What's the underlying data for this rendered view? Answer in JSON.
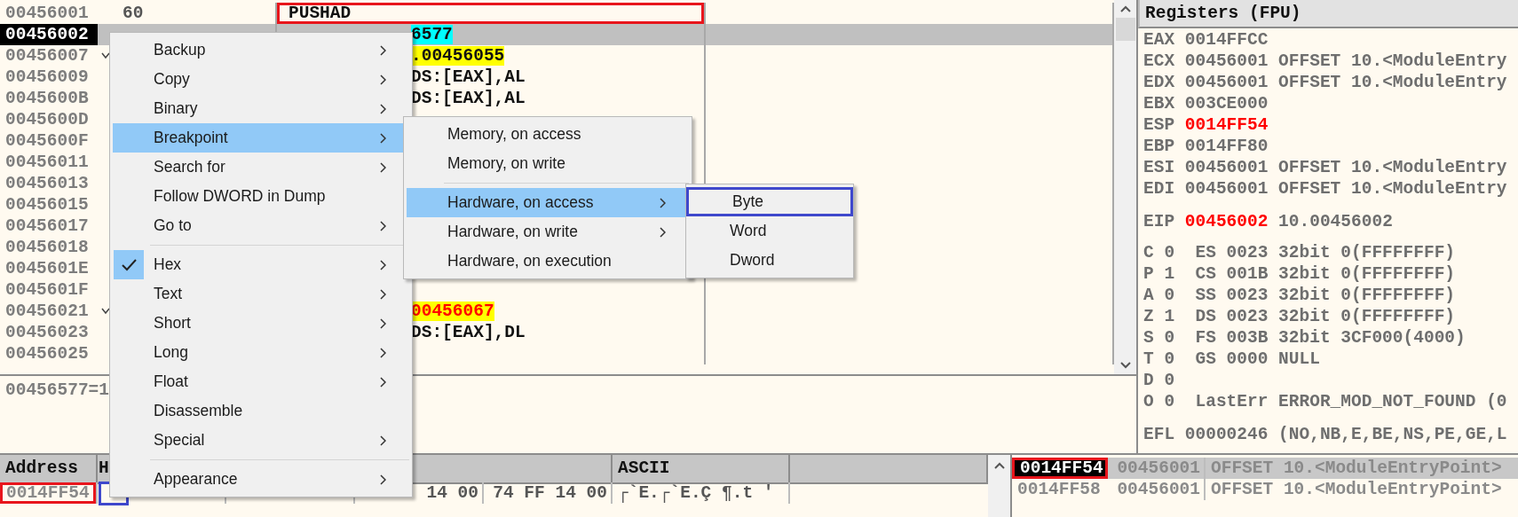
{
  "disassembly": {
    "rows": [
      {
        "address": "00456001",
        "hex": "60",
        "disasm": "PUSHAD",
        "kind": "plain",
        "selected": false,
        "jump": false,
        "framed": true
      },
      {
        "address": "00456002",
        "disasm": "6577",
        "kind": "call",
        "selected": true,
        "jump": false
      },
      {
        "address": "00456007",
        "disasm": ".00456055",
        "kind": "jump",
        "selected": false,
        "jump": true
      },
      {
        "address": "00456009",
        "disasm": "DS:[EAX],AL",
        "selected": false,
        "jump": false
      },
      {
        "address": "0045600B",
        "disasm": "DS:[EAX],AL",
        "selected": false,
        "jump": false
      },
      {
        "address": "0045600D",
        "selected": false,
        "jump": false
      },
      {
        "address": "0045600F",
        "selected": false,
        "jump": false
      },
      {
        "address": "00456011",
        "selected": false,
        "jump": false
      },
      {
        "address": "00456013",
        "selected": false,
        "jump": false
      },
      {
        "address": "00456015",
        "selected": false,
        "jump": false
      },
      {
        "address": "00456017",
        "selected": false,
        "jump": false
      },
      {
        "address": "00456018",
        "selected": false,
        "jump": false
      },
      {
        "address": "0045601E",
        "selected": false,
        "jump": false
      },
      {
        "address": "0045601F",
        "selected": false,
        "jump": false
      },
      {
        "address": "00456021",
        "disasm": "00456067",
        "kind": "jump_target",
        "selected": false,
        "jump": true
      },
      {
        "address": "00456023",
        "disasm": "DS:[EAX],DL",
        "selected": false,
        "jump": false
      },
      {
        "address": "00456025",
        "selected": false,
        "jump": false
      }
    ]
  },
  "info_line": "00456577=1",
  "registers": {
    "title": "Registers (FPU)",
    "general": [
      {
        "name": "EAX",
        "value": "0014FFCC",
        "changed": false
      },
      {
        "name": "ECX",
        "value": "00456001",
        "changed": false,
        "comment": "OFFSET 10.<ModuleEntry"
      },
      {
        "name": "EDX",
        "value": "00456001",
        "changed": false,
        "comment": "OFFSET 10.<ModuleEntry"
      },
      {
        "name": "EBX",
        "value": "003CE000",
        "changed": false
      },
      {
        "name": "ESP",
        "value": "0014FF54",
        "changed": true
      },
      {
        "name": "EBP",
        "value": "0014FF80",
        "changed": false
      },
      {
        "name": "ESI",
        "value": "00456001",
        "changed": false,
        "comment": "OFFSET 10.<ModuleEntry"
      },
      {
        "name": "EDI",
        "value": "00456001",
        "changed": false,
        "comment": "OFFSET 10.<ModuleEntry"
      }
    ],
    "eip": {
      "name": "EIP",
      "value": "00456002",
      "changed": true,
      "comment": "10.00456002"
    },
    "flags": [
      {
        "flag": "C",
        "bit": "0",
        "segment": "ES 0023 32bit 0(FFFFFFFF)"
      },
      {
        "flag": "P",
        "bit": "1",
        "segment": "CS 001B 32bit 0(FFFFFFFF)"
      },
      {
        "flag": "A",
        "bit": "0",
        "segment": "SS 0023 32bit 0(FFFFFFFF)"
      },
      {
        "flag": "Z",
        "bit": "1",
        "segment": "DS 0023 32bit 0(FFFFFFFF)"
      },
      {
        "flag": "S",
        "bit": "0",
        "segment": "FS 003B 32bit 3CF000(4000)"
      },
      {
        "flag": "T",
        "bit": "0",
        "segment": "GS 0000 NULL"
      },
      {
        "flag": "D",
        "bit": "0"
      },
      {
        "flag": "O",
        "bit": "0",
        "segment": "LastErr ERROR_MOD_NOT_FOUND (0"
      }
    ],
    "efl": {
      "name": "EFL",
      "value": "00000246",
      "comment": "(NO,NB,E,BE,NS,PE,GE,L"
    }
  },
  "dump": {
    "address_header": "Address",
    "hex_header": "H",
    "ascii_header": "ASCII",
    "rows": [
      {
        "address": "0014FF54",
        "address_framed": true,
        "hex_framed": true,
        "hex_3": "14 00",
        "hex_4": "74 FF 14 00",
        "ascii": "┌`E.┌`E.Ç  ¶.t '"
      }
    ]
  },
  "stack": {
    "rows": [
      {
        "address": "0014FF54",
        "value": "00456001",
        "comment": "OFFSET 10.<ModuleEntryPoint>",
        "selected": true,
        "framed": true
      },
      {
        "address": "0014FF58",
        "value": "00456001",
        "comment": "OFFSET 10.<ModuleEntryPoint>",
        "selected": false
      }
    ]
  },
  "context_menu": {
    "items": [
      {
        "kind": "item",
        "label": "Backup",
        "has_submenu": true,
        "selected": false,
        "checked": false
      },
      {
        "kind": "item",
        "label": "Copy",
        "has_submenu": true,
        "selected": false,
        "checked": false
      },
      {
        "kind": "item",
        "label": "Binary",
        "has_submenu": true,
        "selected": false,
        "checked": false
      },
      {
        "kind": "item",
        "label": "Breakpoint",
        "has_submenu": true,
        "selected": true,
        "checked": false,
        "submenu": {
          "items": [
            {
              "kind": "item",
              "label": "Memory, on access",
              "has_submenu": false,
              "selected": false,
              "checked": false
            },
            {
              "kind": "item",
              "label": "Memory, on write",
              "has_submenu": false,
              "selected": false,
              "checked": false
            },
            {
              "kind": "separator"
            },
            {
              "kind": "item",
              "label": "Hardware, on access",
              "has_submenu": true,
              "selected": true,
              "checked": false,
              "submenu": {
                "items": [
                  {
                    "kind": "item",
                    "label": "Byte",
                    "has_submenu": false,
                    "selected": false,
                    "checked": false,
                    "framed": true
                  },
                  {
                    "kind": "item",
                    "label": "Word",
                    "has_submenu": false,
                    "selected": false,
                    "checked": false
                  },
                  {
                    "kind": "item",
                    "label": "Dword",
                    "has_submenu": false,
                    "selected": false,
                    "checked": false
                  }
                ]
              }
            },
            {
              "kind": "item",
              "label": "Hardware, on write",
              "has_submenu": true,
              "selected": false,
              "checked": false
            },
            {
              "kind": "item",
              "label": "Hardware, on execution",
              "has_submenu": false,
              "selected": false,
              "checked": false
            }
          ]
        }
      },
      {
        "kind": "item",
        "label": "Search for",
        "has_submenu": true,
        "selected": false,
        "checked": false
      },
      {
        "kind": "item",
        "label": "Follow DWORD in Dump",
        "has_submenu": false,
        "selected": false,
        "checked": false
      },
      {
        "kind": "item",
        "label": "Go to",
        "has_submenu": true,
        "selected": false,
        "checked": false
      },
      {
        "kind": "separator"
      },
      {
        "kind": "item",
        "label": "Hex",
        "has_submenu": true,
        "selected": false,
        "checked": true
      },
      {
        "kind": "item",
        "label": "Text",
        "has_submenu": true,
        "selected": false,
        "checked": false
      },
      {
        "kind": "item",
        "label": "Short",
        "has_submenu": true,
        "selected": false,
        "checked": false
      },
      {
        "kind": "item",
        "label": "Long",
        "has_submenu": true,
        "selected": false,
        "checked": false
      },
      {
        "kind": "item",
        "label": "Float",
        "has_submenu": true,
        "selected": false,
        "checked": false
      },
      {
        "kind": "item",
        "label": "Disassemble",
        "has_submenu": false,
        "selected": false,
        "checked": false
      },
      {
        "kind": "item",
        "label": "Special",
        "has_submenu": true,
        "selected": false,
        "checked": false
      },
      {
        "kind": "separator"
      },
      {
        "kind": "item",
        "label": "Appearance",
        "has_submenu": true,
        "selected": false,
        "checked": false
      }
    ]
  }
}
